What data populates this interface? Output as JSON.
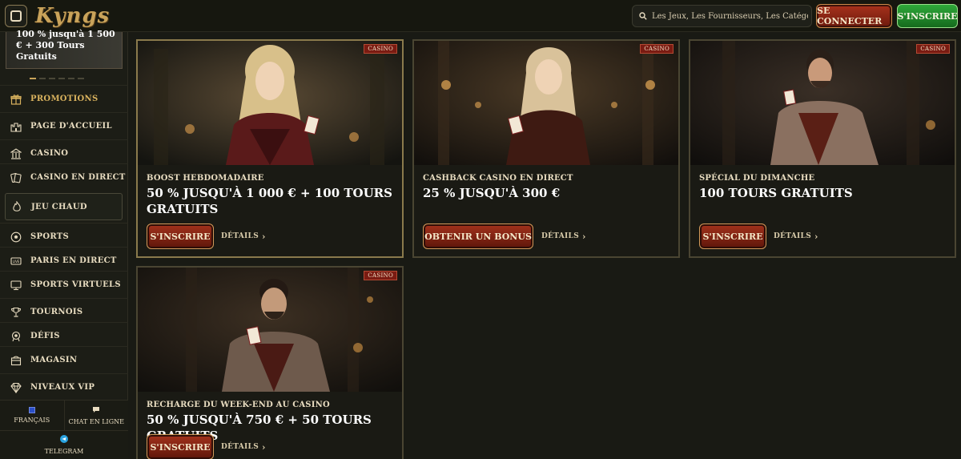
{
  "header": {
    "logo": "Kyngs",
    "search_placeholder": "Les Jeux, Les Fournisseurs, Les Catégories",
    "login_label": "SE CONNECTER",
    "signup_label": "S'INSCRIRE"
  },
  "sidebar": {
    "banner_text": "100 % jusqu'à 1 500 € + 300 Tours Gratuits",
    "items": [
      {
        "label": "PROMOTIONS",
        "icon": "gift-icon"
      },
      {
        "label": "PAGE D'ACCUEIL",
        "icon": "castle-icon"
      },
      {
        "label": "CASINO",
        "icon": "casino-building-icon"
      },
      {
        "label": "CASINO EN DIRECT",
        "icon": "cards-icon"
      },
      {
        "label": "JEU CHAUD",
        "icon": "flame-icon"
      },
      {
        "label": "SPORTS",
        "icon": "soccer-ball-icon"
      },
      {
        "label": "PARIS EN DIRECT",
        "icon": "live-tv-icon"
      },
      {
        "label": "SPORTS VIRTUELS",
        "icon": "monitor-icon"
      },
      {
        "label": "TOURNOIS",
        "icon": "trophy-icon"
      },
      {
        "label": "DÉFIS",
        "icon": "challenge-icon"
      },
      {
        "label": "MAGASIN",
        "icon": "shop-icon"
      },
      {
        "label": "NIVEAUX VIP",
        "icon": "diamond-icon"
      }
    ],
    "language_label": "FRANÇAIS",
    "chat_label": "CHAT EN LIGNE",
    "telegram_label": "TELEGRAM"
  },
  "cards": [
    {
      "tag": "CASINO",
      "subtitle": "BOOST HEBDOMADAIRE",
      "title": "50 % JUSQU'À 1 000 € + 100 TOURS GRATUITS",
      "cta": "S'INSCRIRE",
      "details": "DÉTAILS"
    },
    {
      "tag": "CASINO",
      "subtitle": "CASHBACK CASINO EN DIRECT",
      "title": "25 % JUSQU'À 300 €",
      "cta": "OBTENIR UN BONUS",
      "details": "DÉTAILS"
    },
    {
      "tag": "CASINO",
      "subtitle": "SPÉCIAL DU DIMANCHE",
      "title": "100 TOURS GRATUITS",
      "cta": "S'INSCRIRE",
      "details": "DÉTAILS"
    },
    {
      "tag": "CASINO",
      "subtitle": "RECHARGE DU WEEK-END AU CASINO",
      "title": "50 % JUSQU'À 750 € + 50 TOURS GRATUITS",
      "cta": "S'INSCRIRE",
      "details": "DÉTAILS"
    }
  ],
  "colors": {
    "background": "#191a14",
    "gold_accent": "#c9a35a",
    "cta_red": "#a3321c",
    "signup_green": "#2fa83a"
  }
}
